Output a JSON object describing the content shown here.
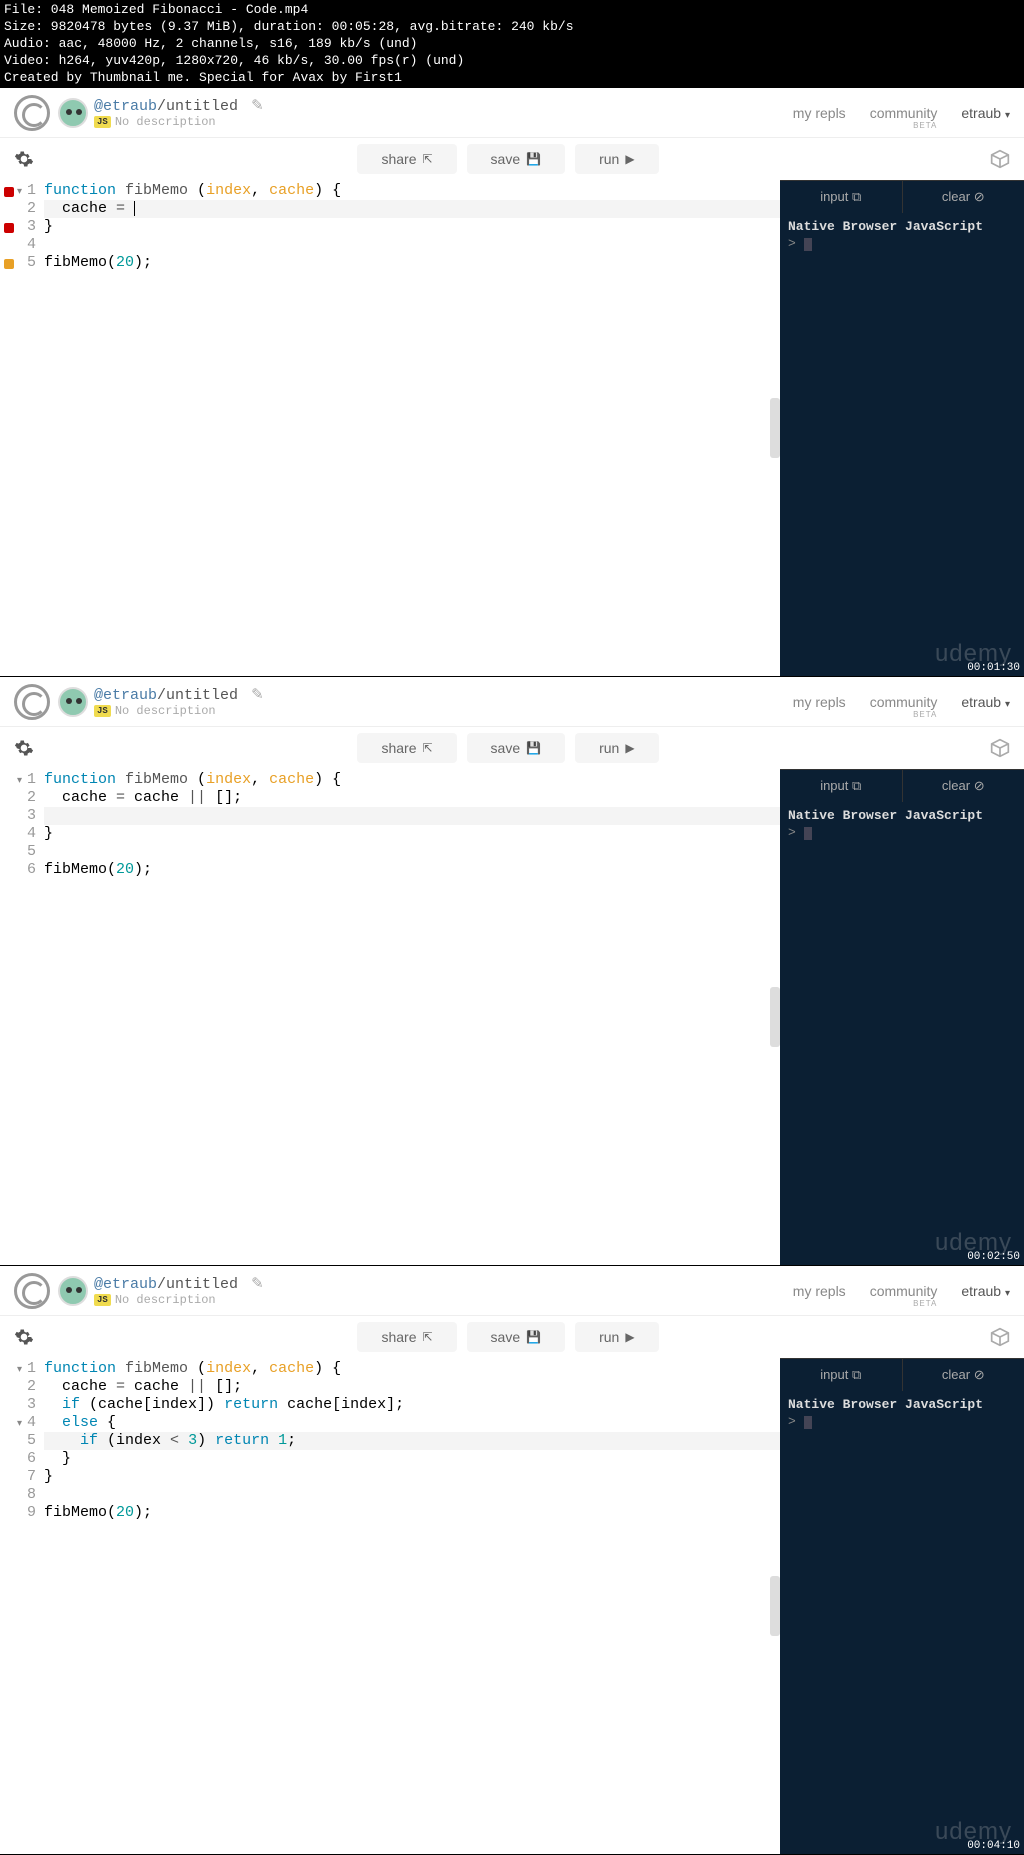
{
  "header": {
    "line1": "File: 048 Memoized Fibonacci - Code.mp4",
    "line2": "Size: 9820478 bytes (9.37 MiB), duration: 00:05:28, avg.bitrate: 240 kb/s",
    "line3": "Audio: aac, 48000 Hz, 2 channels, s16, 189 kb/s (und)",
    "line4": "Video: h264, yuv420p, 1280x720, 46 kb/s, 30.00 fps(r) (und)",
    "line5": "Created by Thumbnail me. Special for Avax by First1"
  },
  "common": {
    "user": "@etraub",
    "sep": "/",
    "project": "untitled",
    "no_desc": "No description",
    "js_badge": "JS",
    "nav": {
      "myrepls": "my repls",
      "community": "community",
      "beta": "BETA",
      "username": "etraub"
    },
    "toolbar": {
      "share": "share",
      "save": "save",
      "run": "run"
    },
    "console": {
      "input": "input",
      "clear": "clear",
      "title": "Native Browser JavaScript",
      "prompt": ">"
    },
    "watermark": "udemy"
  },
  "frames": [
    {
      "timestamp": "00:01:30",
      "lines": [
        {
          "n": "1",
          "err": true,
          "fold": true
        },
        {
          "n": "2",
          "hl": true
        },
        {
          "n": "3",
          "err": true
        },
        {
          "n": "4"
        },
        {
          "n": "5",
          "warn": true
        }
      ]
    },
    {
      "timestamp": "00:02:50",
      "lines": [
        {
          "n": "1",
          "fold": true
        },
        {
          "n": "2"
        },
        {
          "n": "3",
          "hl": true
        },
        {
          "n": "4"
        },
        {
          "n": "5"
        },
        {
          "n": "6"
        }
      ]
    },
    {
      "timestamp": "00:04:10",
      "lines": [
        {
          "n": "1",
          "fold": true
        },
        {
          "n": "2"
        },
        {
          "n": "3"
        },
        {
          "n": "4",
          "fold": true
        },
        {
          "n": "5",
          "hl": true
        },
        {
          "n": "6"
        },
        {
          "n": "7"
        },
        {
          "n": "8"
        },
        {
          "n": "9"
        }
      ]
    }
  ]
}
